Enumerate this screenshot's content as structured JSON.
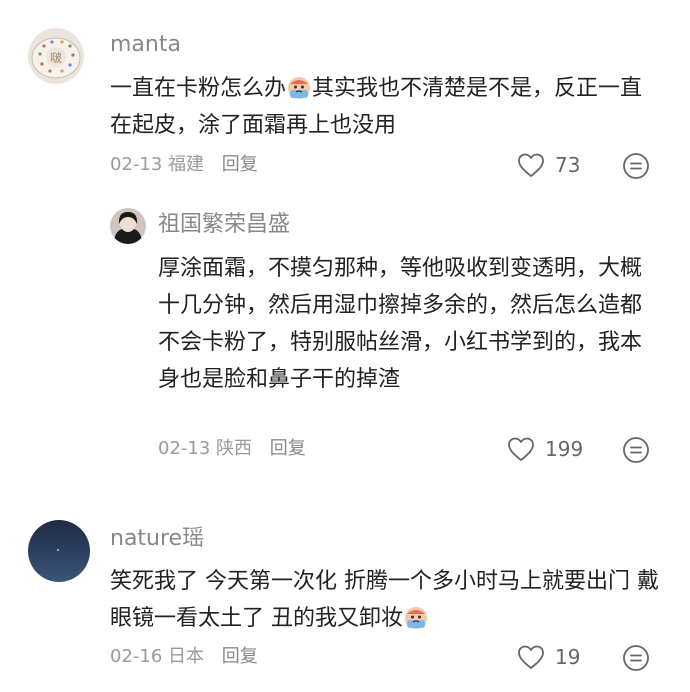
{
  "comments": [
    {
      "username": "manta",
      "text_before_emoji": "一直在卡粉怎么办",
      "emoji": "crying-face-emoji",
      "text_after_emoji": "其实我也不清楚是不是，反正一直在起皮，涂了面霜再上也没用",
      "date": "02-13",
      "location": "福建",
      "reply_label": "回复",
      "likes": "73",
      "replies": [
        {
          "username": "祖国繁荣昌盛",
          "text": "厚涂面霜，不摸匀那种，等他吸收到变透明，大概十几分钟，然后用湿巾擦掉多余的，然后怎么造都不会卡粉了，特别服帖丝滑，小红书学到的，我本身也是脸和鼻子干的掉渣",
          "date": "02-13",
          "location": "陕西",
          "reply_label": "回复",
          "likes": "199"
        }
      ]
    },
    {
      "username": "nature瑶",
      "text_before_emoji": "笑死我了 今天第一次化 折腾一个多小时马上就要出门 戴眼镜一看太土了 丑的我又卸妆",
      "emoji": "crying-face-emoji",
      "text_after_emoji": "",
      "date": "02-16",
      "location": "日本",
      "reply_label": "回复",
      "likes": "19"
    }
  ],
  "colors": {
    "username": "#888888",
    "text": "#222222",
    "meta": "#9a9a9a"
  },
  "icons": {
    "like": "heart-outline-icon",
    "more": "smiley-more-icon"
  }
}
